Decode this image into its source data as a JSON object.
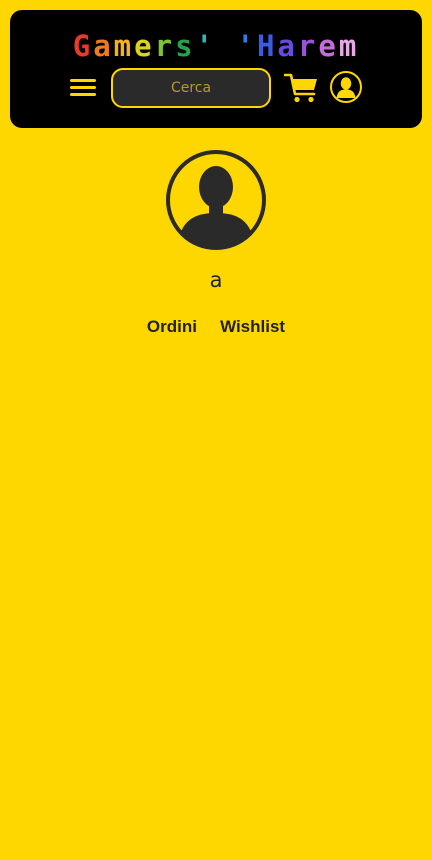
{
  "header": {
    "logo_letters": [
      {
        "char": "G",
        "color": "#E83A2A"
      },
      {
        "char": "a",
        "color": "#F07A22"
      },
      {
        "char": "m",
        "color": "#F5B21C"
      },
      {
        "char": "e",
        "color": "#D9D21E"
      },
      {
        "char": "r",
        "color": "#7DC436"
      },
      {
        "char": "s",
        "color": "#25A24A"
      },
      {
        "char": "'",
        "color": "#2FB8B0"
      },
      {
        "char": " ",
        "color": "#000000"
      },
      {
        "char": "'",
        "color": "#2D7CE0"
      },
      {
        "char": "H",
        "color": "#3A5BE6"
      },
      {
        "char": "a",
        "color": "#6A4AE0"
      },
      {
        "char": "r",
        "color": "#9A52DA"
      },
      {
        "char": "e",
        "color": "#C66CD8"
      },
      {
        "char": "m",
        "color": "#E8A9E6"
      }
    ],
    "search": {
      "placeholder": "Cerca"
    },
    "icons": {
      "menu": "hamburger-menu-icon",
      "cart": "shopping-cart-icon",
      "user": "user-account-icon"
    }
  },
  "profile": {
    "username": "a",
    "avatar_icon": "user-avatar-icon"
  },
  "links": {
    "orders_label": "Ordini",
    "wishlist_label": "Wishlist"
  },
  "colors": {
    "accent": "#FFD700",
    "header_bg": "#000000",
    "text": "#222222",
    "search_bg": "#2A2A2A"
  }
}
